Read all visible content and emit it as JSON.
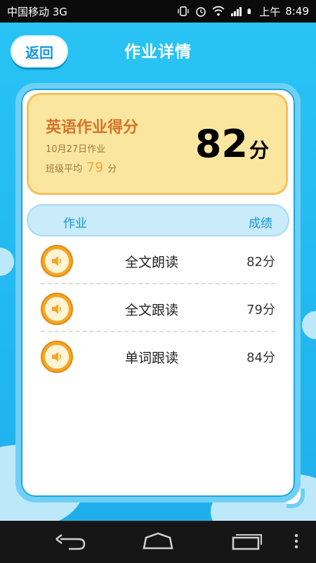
{
  "status_bar": {
    "carrier": "中国移动 3G",
    "ampm": "上午",
    "time": "8:49"
  },
  "header": {
    "back_label": "返回",
    "title": "作业详情"
  },
  "score_card": {
    "title": "英语作业得分",
    "date_label": "10月27日作业",
    "avg_prefix": "班级平均",
    "avg_value": "79",
    "avg_unit": "分",
    "score_value": "82",
    "score_unit": "分"
  },
  "table": {
    "col_task": "作业",
    "col_score": "成绩",
    "rows": [
      {
        "label": "全文朗读",
        "score": "82分",
        "icon": "speaker-icon"
      },
      {
        "label": "全文跟读",
        "score": "79分",
        "icon": "speaker-icon"
      },
      {
        "label": "单词跟读",
        "score": "84分",
        "icon": "speaker-icon"
      }
    ]
  },
  "nav": {
    "icons": [
      "back-icon",
      "home-icon",
      "recent-apps-icon",
      "menu-icon"
    ]
  },
  "colors": {
    "accent_blue": "#2bb7ef",
    "score_panel": "#fbe6a0",
    "score_title": "#d5732a",
    "speaker_orange": "#f6a623"
  }
}
